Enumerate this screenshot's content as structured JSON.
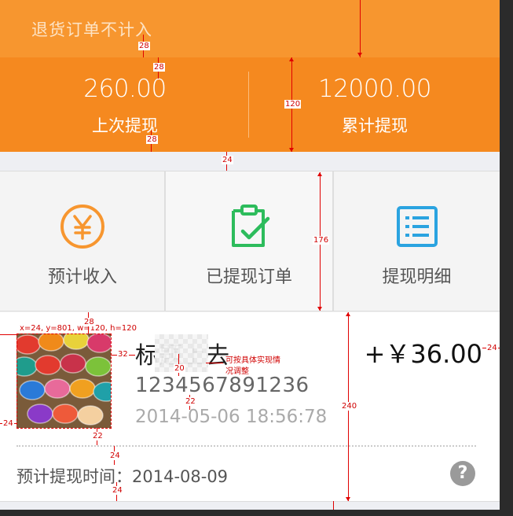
{
  "header": {
    "note": "退货订单不计入"
  },
  "stats": [
    {
      "value": "260.00",
      "label": "上次提现"
    },
    {
      "value": "12000.00",
      "label": "累计提现"
    }
  ],
  "menu": [
    {
      "label": "预计收入",
      "icon": "yen-circle-icon"
    },
    {
      "label": "已提现订单",
      "icon": "clipboard-check-icon"
    },
    {
      "label": "提现明细",
      "icon": "list-icon"
    }
  ],
  "order": {
    "product_name": "标题上去",
    "order_no": "1234567891236",
    "time": "2014-05-06  18:56:78",
    "amount": "+￥36.00",
    "expect_label": "预计提现时间：",
    "expect_value": "2014-08-09",
    "help_icon": "?"
  },
  "annotations": {
    "thumb_spec": "x=24, y=801, w=120, h=120",
    "note_text_1": "可按具体实现情",
    "note_text_2": "况调整",
    "d28": "28",
    "d120": "120",
    "d24": "24",
    "d176": "176",
    "d32": "32",
    "d20": "20",
    "d22": "22",
    "d240": "240"
  },
  "colors": {
    "orange_top": "#f7962f",
    "orange_stats": "#f5891f",
    "green": "#2dbc5c",
    "blue": "#2aa3e0"
  }
}
